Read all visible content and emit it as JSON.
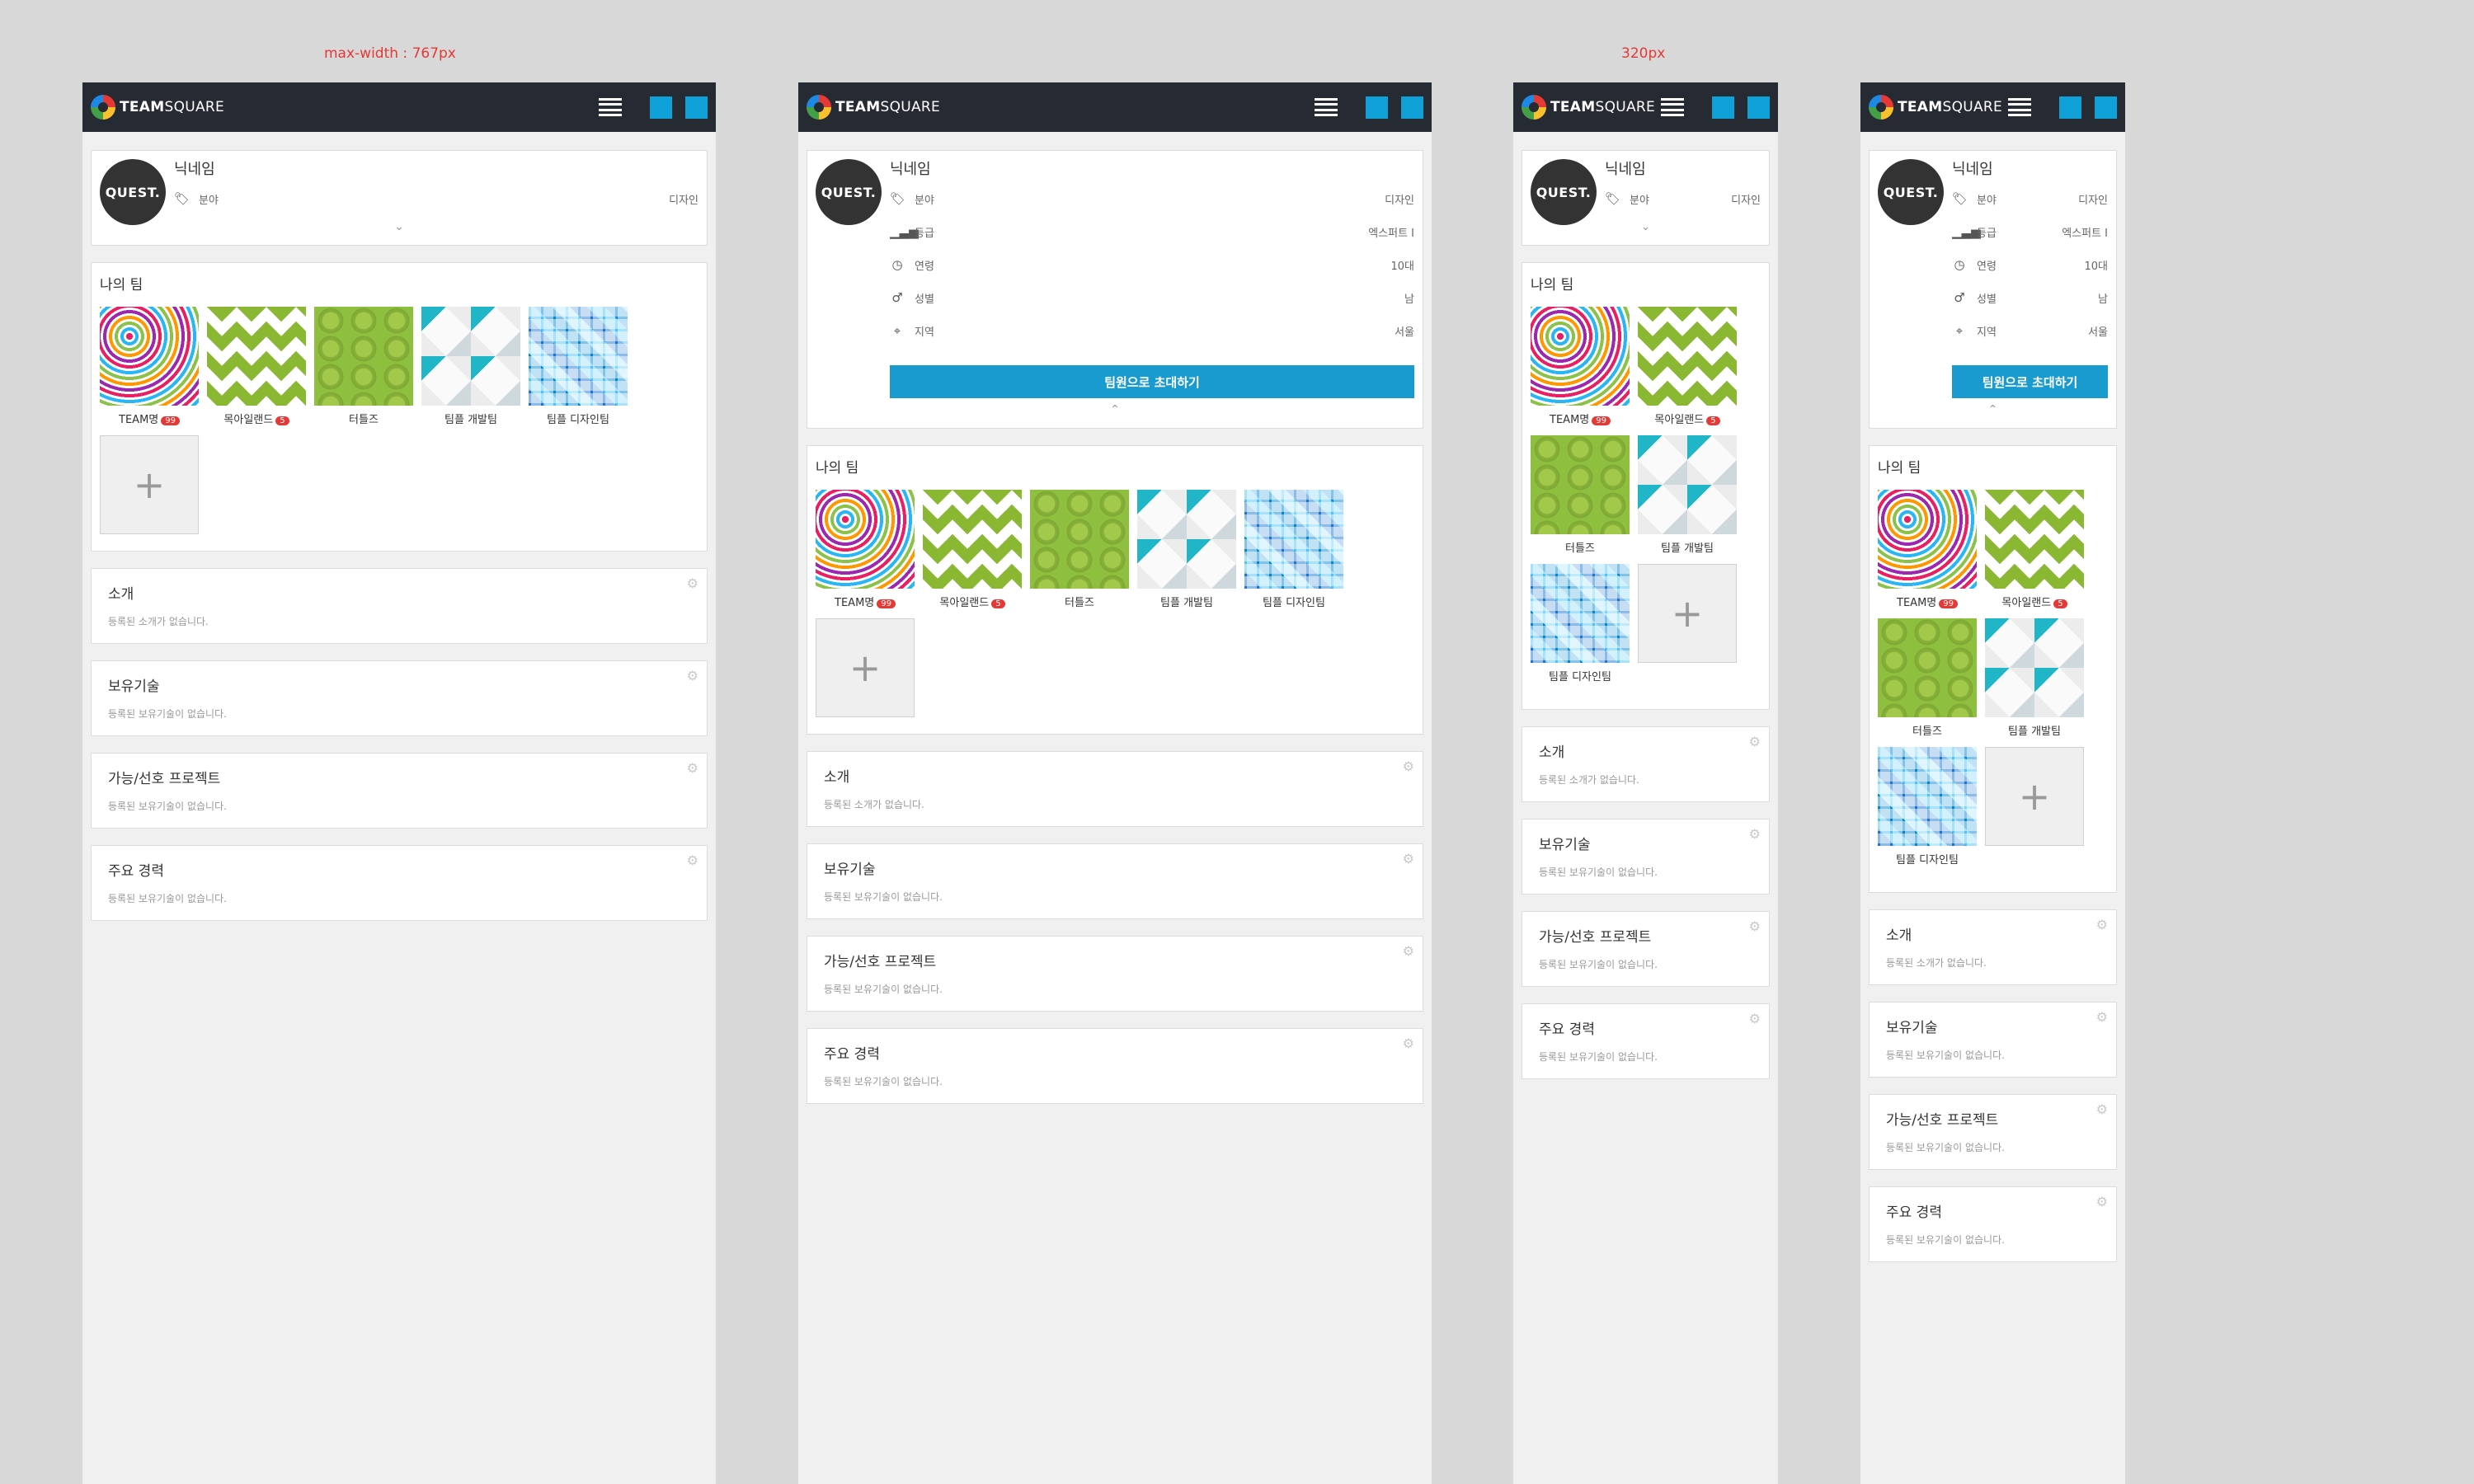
{
  "annotations": {
    "wide_label": "max-width : 767px",
    "narrow_label": "320px"
  },
  "header": {
    "logo_bold": "TEAM",
    "logo_light": "SQUARE"
  },
  "profile": {
    "avatar_text": "QUEST.",
    "nickname": "닉네임",
    "invite_label": "팀원으로 초대하기",
    "collapse_icon": "chevron-down",
    "expand_icon": "chevron-up",
    "rows": [
      {
        "key": "field",
        "icon": "tag-icon",
        "label": "분야",
        "value": "디자인"
      },
      {
        "key": "grade",
        "icon": "bar-chart-icon",
        "label": "등급",
        "value": "엑스퍼트 I"
      },
      {
        "key": "age",
        "icon": "clock-icon",
        "label": "연령",
        "value": "10대"
      },
      {
        "key": "gender",
        "icon": "male-icon",
        "label": "성별",
        "value": "남"
      },
      {
        "key": "region",
        "icon": "location-icon",
        "label": "지역",
        "value": "서울"
      }
    ]
  },
  "teams": {
    "title": "나의 팀",
    "add_label": "+",
    "items": [
      {
        "name": "TEAM명",
        "badge": "99",
        "pattern": "rings"
      },
      {
        "name": "목아일랜드",
        "badge": "5",
        "pattern": "zigzag"
      },
      {
        "name": "터틀즈",
        "badge": "",
        "pattern": "hex"
      },
      {
        "name": "팀플 개발팀",
        "badge": "",
        "pattern": "diamond"
      },
      {
        "name": "팀플 디자인팀",
        "badge": "",
        "pattern": "mosaic"
      }
    ]
  },
  "sections": [
    {
      "title": "소개",
      "desc": "등록된 소개가 없습니다."
    },
    {
      "title": "보유기술",
      "desc": "등록된 보유기술이 없습니다."
    },
    {
      "title": "가능/선호 프로젝트",
      "desc": "등록된 보유기술이 없습니다."
    },
    {
      "title": "주요 경력",
      "desc": "등록된 보유기술이 없습니다."
    }
  ],
  "colors": {
    "topbar": "#262a33",
    "accent": "#0fa0d8",
    "invite": "#1a9bd0",
    "badge": "#e53935",
    "annotation": "#e53935"
  }
}
